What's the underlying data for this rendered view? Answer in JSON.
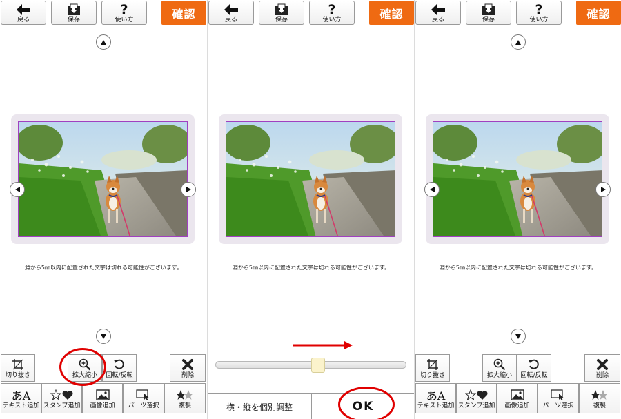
{
  "toolbar": {
    "back_label": "戻る",
    "save_label": "保存",
    "help_label": "使い方",
    "confirm_label": "確認"
  },
  "notice": "淵から5㎜以内に配置された文字は切れる可能性がございます。",
  "tools": {
    "crop": "切り抜き",
    "zoom": "拡大縮小",
    "rotate": "回転/反転",
    "delete": "削除",
    "text_add": "テキスト追加",
    "text_icon_glyph": "あA",
    "stamp_add": "スタンプ追加",
    "image_add": "画像追加",
    "parts_select": "パーツ選択",
    "copy": "複製"
  },
  "adjust": {
    "separate_label": "横・縦を個別調整",
    "ok_label": "OK",
    "slider_value_percent": 54
  },
  "colors": {
    "confirm_bg": "#ef6a12",
    "highlight_red": "#e00000",
    "frame_bg": "#ebe6ee"
  }
}
